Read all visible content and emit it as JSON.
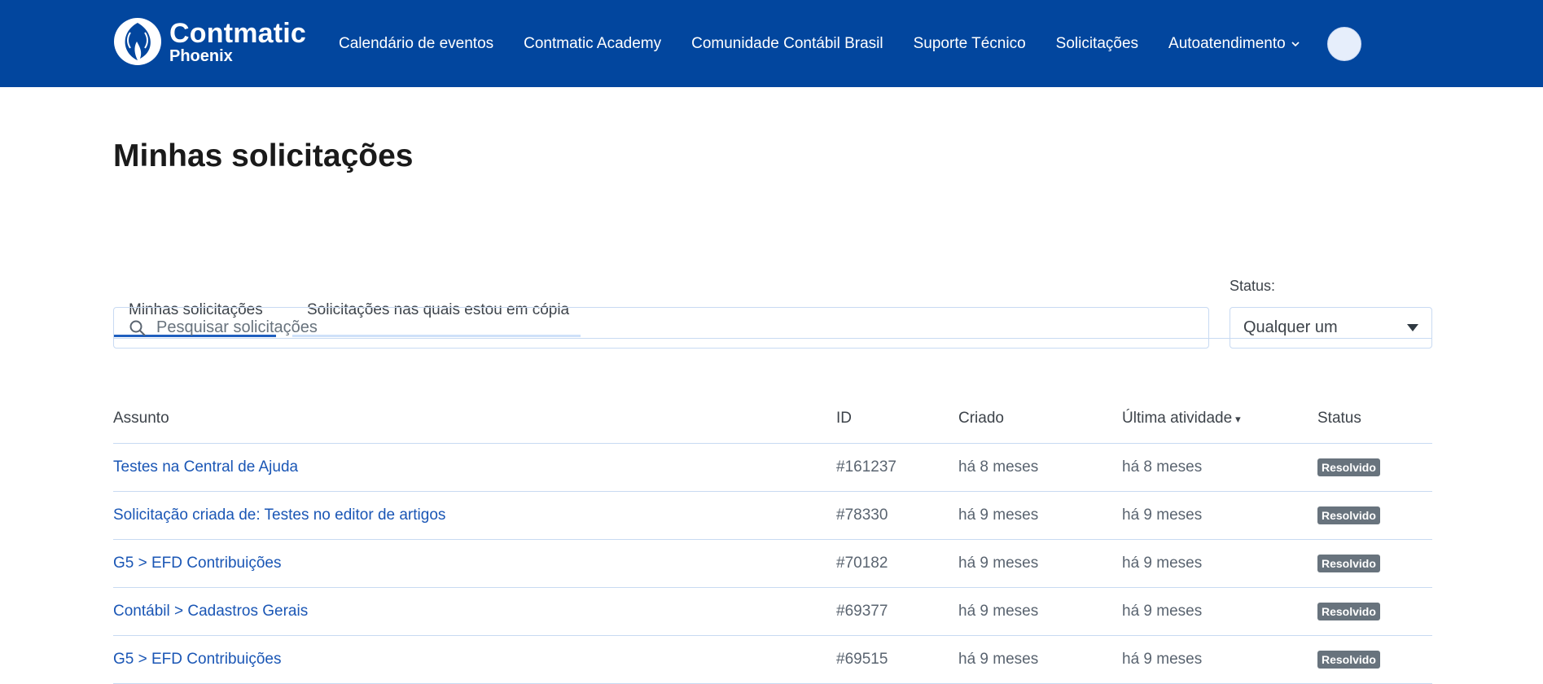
{
  "header": {
    "brand": "Contmatic",
    "brand_sub": "Phoenix",
    "nav": [
      {
        "label": "Calendário de eventos"
      },
      {
        "label": "Contmatic Academy"
      },
      {
        "label": "Comunidade Contábil Brasil"
      },
      {
        "label": "Suporte Técnico"
      },
      {
        "label": "Solicitações"
      },
      {
        "label": "Autoatendimento"
      }
    ],
    "accent_color": "#02469e"
  },
  "page": {
    "title": "Minhas solicitações",
    "tabs": [
      {
        "label": "Minhas solicitações",
        "active": true
      },
      {
        "label": "Solicitações nas quais estou em cópia",
        "active": false
      }
    ],
    "search": {
      "placeholder": "Pesquisar solicitações",
      "value": ""
    },
    "status_filter": {
      "label": "Status:",
      "selected": "Qualqu‍er um"
    }
  },
  "table": {
    "columns": [
      "Assunto",
      "ID",
      "Criado",
      "Última atividade",
      "Status"
    ],
    "sort_indicator": "▾",
    "rows": [
      {
        "subject": "Testes na Central de Ajuda",
        "id": "#161237",
        "created": "há 8 meses",
        "last_activity": "há 8 meses",
        "status": "Resolvido"
      },
      {
        "subject": "Solicitação criada de: Testes no editor de artigos",
        "id": "#78330",
        "created": "há 9 meses",
        "last_activity": "há 9 meses",
        "status": "Resolvido"
      },
      {
        "subject": "G5 > EFD Contribuições",
        "id": "#70182",
        "created": "há 9 meses",
        "last_activity": "há 9 meses",
        "status": "Resolvido"
      },
      {
        "subject": "Contábil > Cadastros Gerais",
        "id": "#69377",
        "created": "há 9 meses",
        "last_activity": "há 9 meses",
        "status": "Resolvido"
      },
      {
        "subject": "G5 > EFD Contribuições",
        "id": "#69515",
        "created": "há 9 meses",
        "last_activity": "há 9 meses",
        "status": "Resolvido"
      }
    ]
  }
}
